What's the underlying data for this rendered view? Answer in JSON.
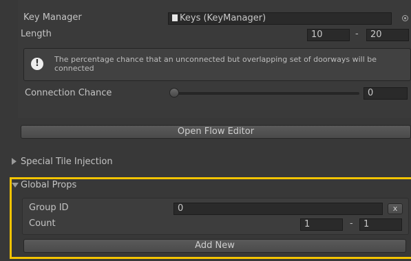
{
  "key_manager": {
    "label": "Key Manager",
    "value": "Keys (KeyManager)",
    "value_icon": "document-icon",
    "picker_icon": "object-picker-icon"
  },
  "length": {
    "label": "Length",
    "min": "10",
    "separator": "-",
    "max": "20"
  },
  "help_box": {
    "icon": "info-icon",
    "text": "The percentage chance that an unconnected but overlapping set of doorways will be connected"
  },
  "connection_chance": {
    "label": "Connection Chance",
    "value": "0",
    "fraction": 0
  },
  "open_flow_editor": {
    "label": "Open Flow Editor"
  },
  "special_tile_injection": {
    "label": "Special Tile Injection",
    "expanded": false
  },
  "global_props": {
    "label": "Global Props",
    "expanded": true,
    "highlight_color": "#f5c400",
    "group_id": {
      "label": "Group ID",
      "value": "0",
      "remove_label": "x"
    },
    "count": {
      "label": "Count",
      "min": "1",
      "separator": "-",
      "max": "1"
    },
    "add_new": {
      "label": "Add New"
    }
  }
}
